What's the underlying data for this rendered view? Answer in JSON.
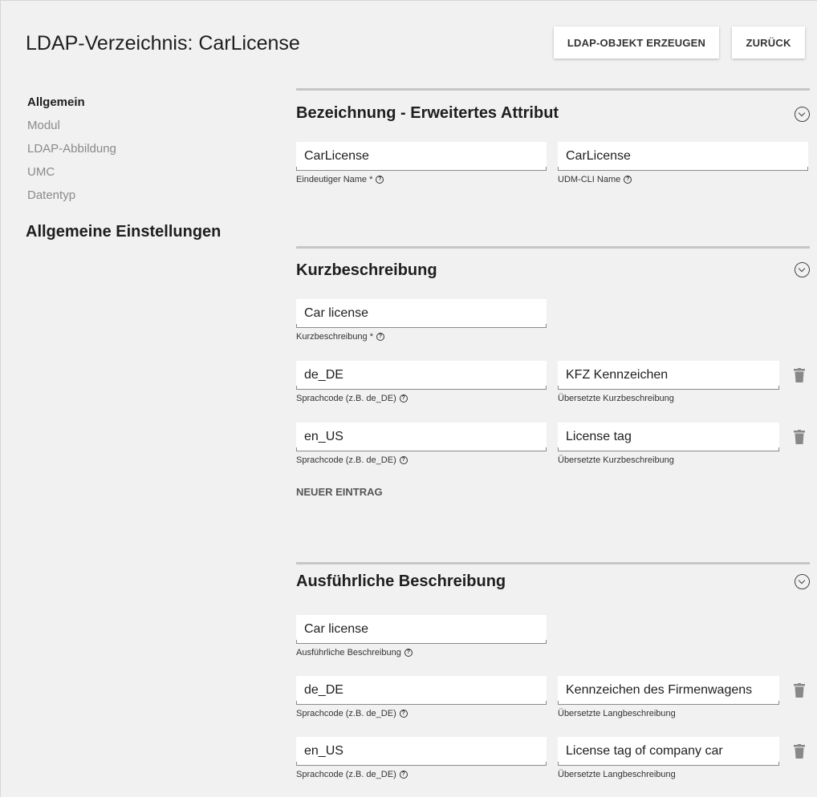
{
  "header": {
    "title": "LDAP-Verzeichnis: CarLicense",
    "create_button": "LDAP-OBJEKT ERZEUGEN",
    "back_button": "ZURÜCK"
  },
  "sidebar": {
    "items": [
      {
        "label": "Allgemein",
        "active": true
      },
      {
        "label": "Modul",
        "active": false
      },
      {
        "label": "LDAP-Abbildung",
        "active": false
      },
      {
        "label": "UMC",
        "active": false
      },
      {
        "label": "Datentyp",
        "active": false
      }
    ],
    "section_heading": "Allgemeine Einstellungen"
  },
  "sections": {
    "bezeichnung": {
      "title": "Bezeichnung - Erweitertes Attribut",
      "unique_name": {
        "value": "CarLicense",
        "label": "Eindeutiger Name *"
      },
      "udm_cli_name": {
        "value": "CarLicense",
        "label": "UDM-CLI Name"
      }
    },
    "kurzbeschreibung": {
      "title": "Kurzbeschreibung",
      "main": {
        "value": "Car license",
        "label": "Kurzbeschreibung *"
      },
      "translations": [
        {
          "lang": "de_DE",
          "lang_label": "Sprachcode (z.B. de_DE)",
          "text": "KFZ Kennzeichen",
          "text_label": "Übersetzte Kurzbeschreibung"
        },
        {
          "lang": "en_US",
          "lang_label": "Sprachcode (z.B. de_DE)",
          "text": "License tag",
          "text_label": "Übersetzte Kurzbeschreibung"
        }
      ],
      "add_entry": "NEUER EINTRAG"
    },
    "ausfuehrlich": {
      "title": "Ausführliche Beschreibung",
      "main": {
        "value": "Car license",
        "label": "Ausführliche Beschreibung"
      },
      "translations": [
        {
          "lang": "de_DE",
          "lang_label": "Sprachcode (z.B. de_DE)",
          "text": "Kennzeichen des Firmenwagens",
          "text_label": "Übersetzte Langbeschreibung"
        },
        {
          "lang": "en_US",
          "lang_label": "Sprachcode (z.B. de_DE)",
          "text": "License tag of company car",
          "text_label": "Übersetzte Langbeschreibung"
        }
      ]
    }
  },
  "icons": {
    "help": "help-circle-icon",
    "toggle": "chevron-circle-down-icon",
    "delete": "trash-icon"
  },
  "colors": {
    "background": "#f1f1f1",
    "section_rule": "#c6c6c6",
    "muted_text": "#8a8a8a"
  }
}
